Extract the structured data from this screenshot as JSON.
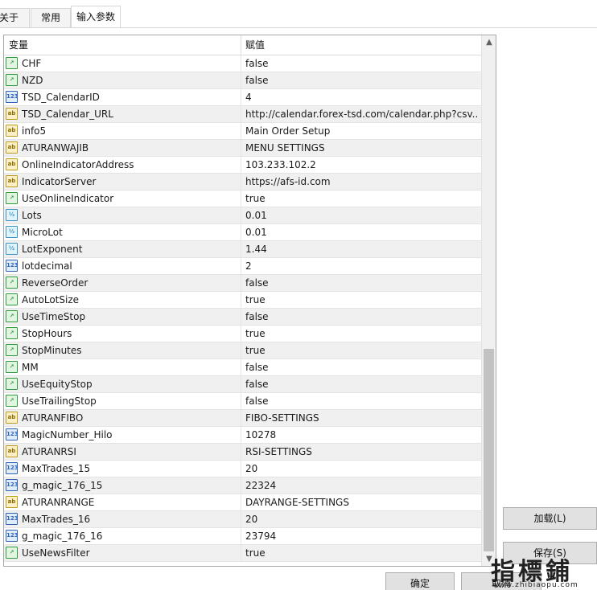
{
  "tabs": [
    {
      "label": "关于",
      "active": false
    },
    {
      "label": "常用",
      "active": false
    },
    {
      "label": "输入参数",
      "active": true
    }
  ],
  "grid": {
    "header": {
      "variable": "变量",
      "value": "赋值"
    },
    "icon_labels": {
      "bool": "↗",
      "int": "123",
      "str": "ab",
      "dbl": "½"
    },
    "rows": [
      {
        "type": "bool",
        "name": "CHF",
        "value": "false"
      },
      {
        "type": "bool",
        "name": "NZD",
        "value": "false"
      },
      {
        "type": "int",
        "name": "TSD_CalendarID",
        "value": "4"
      },
      {
        "type": "str",
        "name": "TSD_Calendar_URL",
        "value": " http://calendar.forex-tsd.com/calendar.php?csv..."
      },
      {
        "type": "str",
        "name": "info5",
        "value": " Main Order Setup"
      },
      {
        "type": "str",
        "name": "ATURANWAJIB",
        "value": "MENU SETTINGS"
      },
      {
        "type": "str",
        "name": "OnlineIndicatorAddress",
        "value": "103.233.102.2"
      },
      {
        "type": "str",
        "name": "IndicatorServer",
        "value": "https://afs-id.com"
      },
      {
        "type": "bool",
        "name": "UseOnlineIndicator",
        "value": "true"
      },
      {
        "type": "dbl",
        "name": "Lots",
        "value": "0.01"
      },
      {
        "type": "dbl",
        "name": "MicroLot",
        "value": "0.01"
      },
      {
        "type": "dbl",
        "name": "LotExponent",
        "value": "1.44"
      },
      {
        "type": "int",
        "name": "lotdecimal",
        "value": "2"
      },
      {
        "type": "bool",
        "name": "ReverseOrder",
        "value": "false"
      },
      {
        "type": "bool",
        "name": "AutoLotSize",
        "value": "true"
      },
      {
        "type": "bool",
        "name": "UseTimeStop",
        "value": "false"
      },
      {
        "type": "bool",
        "name": "StopHours",
        "value": "true"
      },
      {
        "type": "bool",
        "name": "StopMinutes",
        "value": "true"
      },
      {
        "type": "bool",
        "name": "MM",
        "value": "false"
      },
      {
        "type": "bool",
        "name": "UseEquityStop",
        "value": "false"
      },
      {
        "type": "bool",
        "name": "UseTrailingStop",
        "value": "false"
      },
      {
        "type": "str",
        "name": "ATURANFIBO",
        "value": "FIBO-SETTINGS"
      },
      {
        "type": "int",
        "name": "MagicNumber_Hilo",
        "value": "10278"
      },
      {
        "type": "str",
        "name": "ATURANRSI",
        "value": "RSI-SETTINGS"
      },
      {
        "type": "int",
        "name": "MaxTrades_15",
        "value": "20"
      },
      {
        "type": "int",
        "name": "g_magic_176_15",
        "value": "22324"
      },
      {
        "type": "str",
        "name": "ATURANRANGE",
        "value": "DAYRANGE-SETTINGS"
      },
      {
        "type": "int",
        "name": "MaxTrades_16",
        "value": "20"
      },
      {
        "type": "int",
        "name": "g_magic_176_16",
        "value": "23794"
      },
      {
        "type": "bool",
        "name": "UseNewsFilter",
        "value": "true"
      }
    ]
  },
  "scrollbar": {
    "up": "▲",
    "down": "▼"
  },
  "buttons": {
    "load": "加载(L)",
    "save": "保存(S)",
    "ok": "确定",
    "cancel": "取消"
  },
  "watermark": {
    "big": "指標鋪",
    "small": "www.zhibiaopu.com"
  },
  "colors": {
    "bool": "#2f9a3c",
    "int": "#2c63b6",
    "str": "#c09a1c",
    "dbl": "#3a93c8",
    "row_shade": "#f0f0f0"
  }
}
